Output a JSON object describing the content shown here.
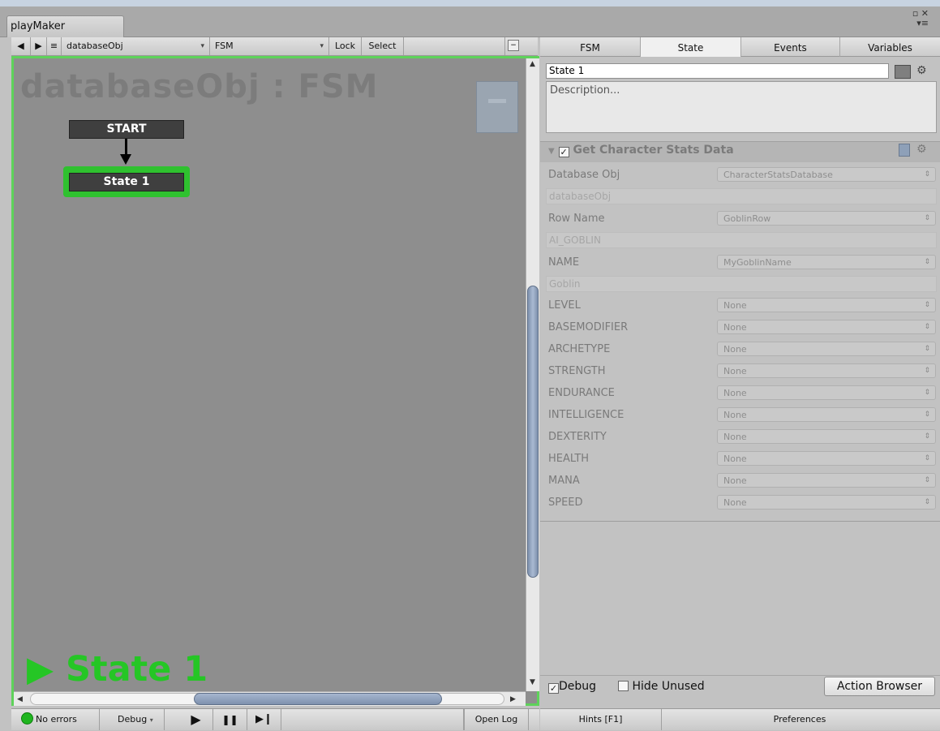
{
  "window": {
    "tab_title": "playMaker",
    "controls": "▫ ✕"
  },
  "canvas_toolbar": {
    "back_glyph": "◀",
    "forward_glyph": "▶",
    "menu_glyph": "≡",
    "gameobject_select": "databaseObj",
    "fsm_select": "FSM",
    "lock_label": "Lock",
    "select_label": "Select"
  },
  "canvas": {
    "title": "databaseObj : FSM",
    "start_node": "START",
    "state_node": "State 1",
    "status": "▶ State 1",
    "accent": "#2fc12f"
  },
  "status_bar": {
    "errors": "No errors",
    "debug_label": "Debug",
    "play_glyph": "▶",
    "pause_glyph": "❚❚",
    "step_glyph": "▶❙",
    "open_log": "Open Log"
  },
  "inspector": {
    "tabs": [
      {
        "label": "FSM"
      },
      {
        "label": "State"
      },
      {
        "label": "Events"
      },
      {
        "label": "Variables"
      }
    ],
    "state_name": "State 1",
    "description_placeholder": "Description...",
    "action": {
      "title": "Get Character Stats Data",
      "params": [
        {
          "label": "Database Obj",
          "value": "CharacterStatsDatabase",
          "sub": "databaseObj"
        },
        {
          "label": "Row Name",
          "value": "GoblinRow",
          "sub": "AI_GOBLIN"
        },
        {
          "label": "NAME",
          "value": "MyGoblinName",
          "sub": "Goblin"
        },
        {
          "label": "LEVEL",
          "value": "None"
        },
        {
          "label": "BASEMODIFIER",
          "value": "None"
        },
        {
          "label": "ARCHETYPE",
          "value": "None"
        },
        {
          "label": "STRENGTH",
          "value": "None"
        },
        {
          "label": "ENDURANCE",
          "value": "None"
        },
        {
          "label": "INTELLIGENCE",
          "value": "None"
        },
        {
          "label": "DEXTERITY",
          "value": "None"
        },
        {
          "label": "HEALTH",
          "value": "None"
        },
        {
          "label": "MANA",
          "value": "None"
        },
        {
          "label": "SPEED",
          "value": "None"
        }
      ]
    },
    "debug_label": "Debug",
    "hide_unused_label": "Hide Unused",
    "action_browser_label": "Action Browser",
    "hints_label": "Hints [F1]",
    "preferences_label": "Preferences"
  }
}
